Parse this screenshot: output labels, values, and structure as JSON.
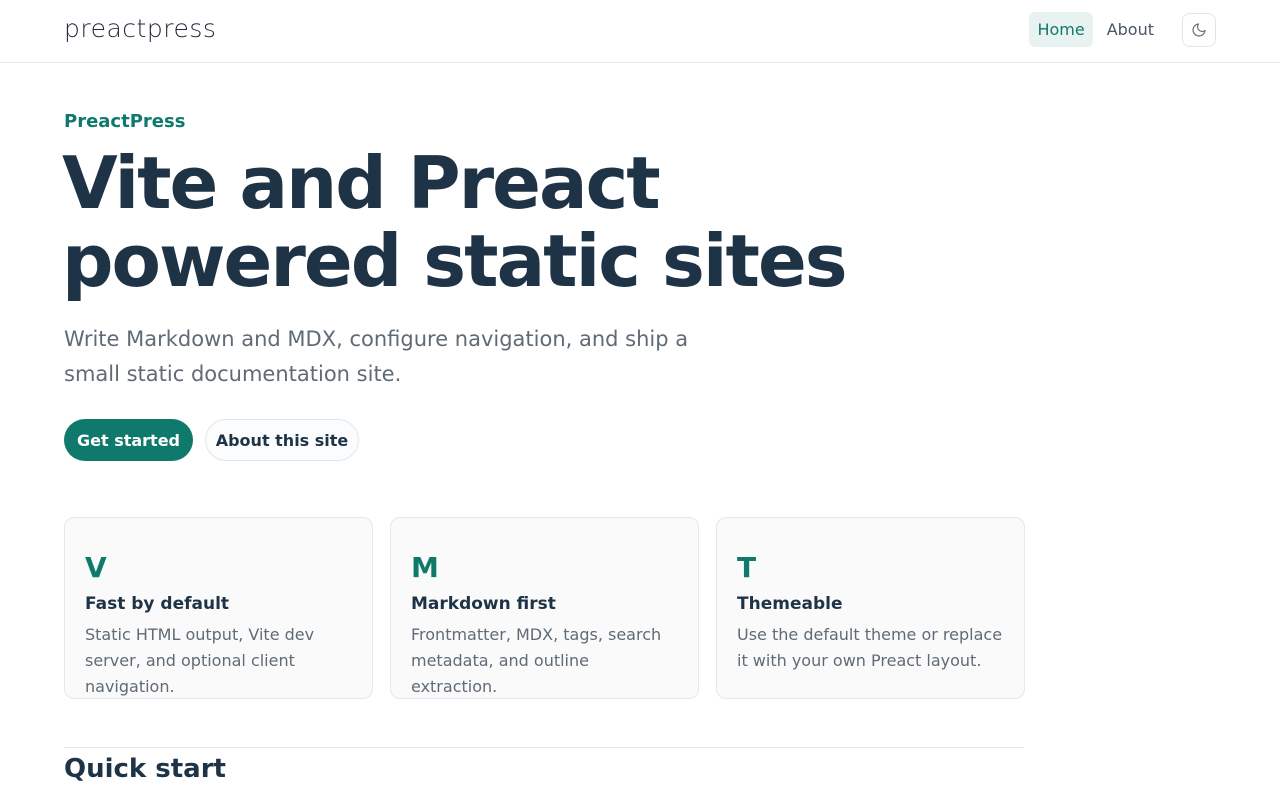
{
  "header": {
    "logo": "preactpress",
    "nav": [
      {
        "label": "Home",
        "active": true
      },
      {
        "label": "About",
        "active": false
      }
    ],
    "theme_toggle_icon": "moon-icon"
  },
  "hero": {
    "eyebrow": "PreactPress",
    "title_line1": "Vite and Preact",
    "title_line2": "powered static sites",
    "subtitle": "Write Markdown and MDX, configure navigation, and ship a small static documentation site.",
    "primary_button": "Get started",
    "secondary_button": "About this site"
  },
  "features": [
    {
      "letter": "V",
      "title": "Fast by default",
      "description": "Static HTML output, Vite dev server, and optional client navigation."
    },
    {
      "letter": "M",
      "title": "Markdown first",
      "description": "Frontmatter, MDX, tags, search metadata, and outline extraction."
    },
    {
      "letter": "T",
      "title": "Themeable",
      "description": "Use the default theme or replace it with your own Preact layout."
    }
  ],
  "section": {
    "title": "Quick start"
  },
  "colors": {
    "accent": "#0f7a6c",
    "heading": "#1f3347",
    "muted": "#5f6b77"
  }
}
